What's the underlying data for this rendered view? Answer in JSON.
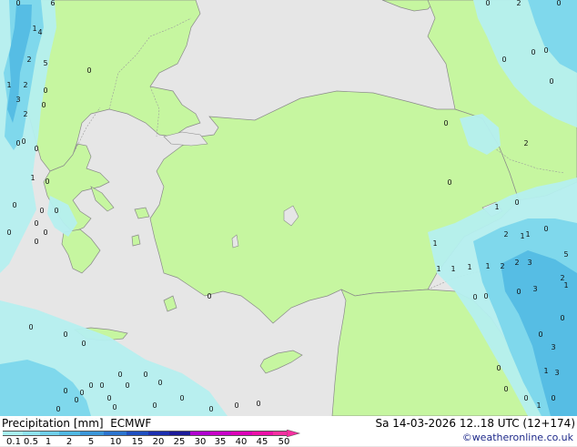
{
  "footer": {
    "title": "Precipitation [mm]  ECMWF",
    "datetime": "Sa 14-03-2026 12..18 UTC (12+174)",
    "credit": "©weatheronline.co.uk"
  },
  "legend": {
    "labels": [
      "0.1",
      "0.5",
      "1",
      "2",
      "5",
      "10",
      "15",
      "20",
      "25",
      "30",
      "35",
      "40",
      "45",
      "50"
    ],
    "colors": [
      "#a8f0f0",
      "#8ee3ef",
      "#6fcfea",
      "#4fb8e3",
      "#3b96d9",
      "#2b74cf",
      "#1f4fc0",
      "#1b2fb0",
      "#1b1a9a",
      "#b000d0",
      "#c800c8",
      "#dc00b8",
      "#ec10a8",
      "#f830a0"
    ]
  },
  "colors": {
    "sea": "#e6e6e6",
    "land": "#c6f6a0",
    "precip_light": "#b5efef",
    "precip_mid": "#7fd8ec",
    "precip_heavy": "#56bde4"
  },
  "values": [
    "0",
    "1",
    "2",
    "5",
    "0",
    "1",
    "2",
    "4",
    "2",
    "3",
    "6",
    "0",
    "0",
    "0",
    "0",
    "1",
    "0",
    "0",
    "0",
    "0",
    "0",
    "0",
    "0",
    "0",
    "0",
    "0",
    "0",
    "0",
    "0",
    "0",
    "0",
    "0",
    "1",
    "0",
    "0",
    "0",
    "0",
    "2",
    "0",
    "0",
    "0",
    "0",
    "1",
    "2",
    "1",
    "0",
    "1",
    "1",
    "1",
    "1",
    "2",
    "2",
    "3",
    "1",
    "0",
    "1",
    "0",
    "2",
    "5",
    "3",
    "0",
    "2",
    "0",
    "0",
    "0",
    "3",
    "1",
    "0",
    "3",
    "0",
    "0",
    "0",
    "1",
    "0",
    "0",
    "0",
    "0",
    "0",
    "0",
    "0",
    "0",
    "0",
    "0",
    "0",
    "0",
    "0",
    "0"
  ]
}
